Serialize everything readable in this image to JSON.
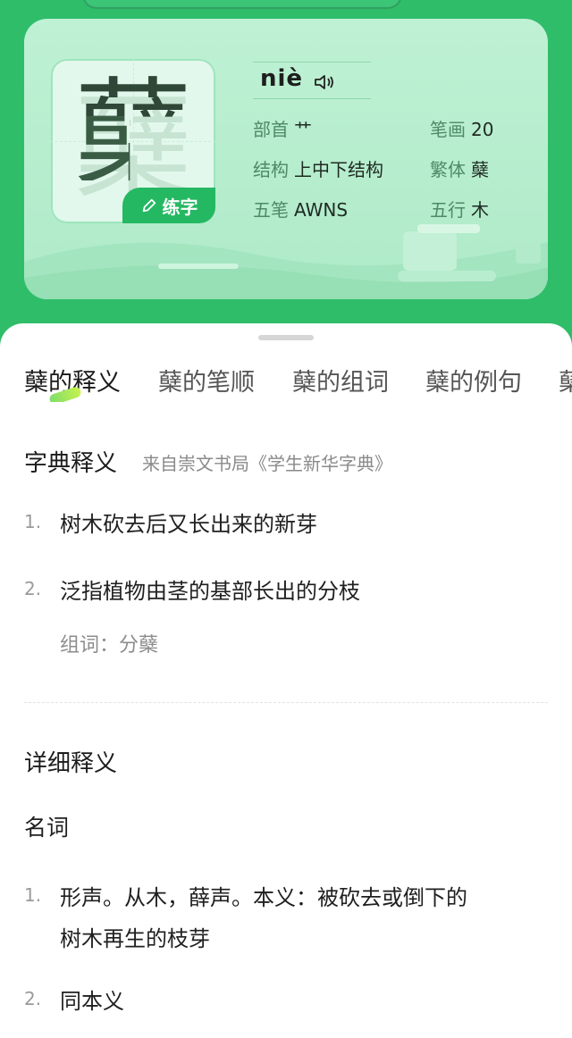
{
  "card": {
    "character": "蘖",
    "practice_label": "练字",
    "pinyin": "niè",
    "info": [
      {
        "label": "部首",
        "value": "艹"
      },
      {
        "label": "笔画",
        "value": "20"
      },
      {
        "label": "结构",
        "value": "上中下结构"
      },
      {
        "label": "繁体",
        "value": "蘖"
      },
      {
        "label": "五笔",
        "value": "AWNS"
      },
      {
        "label": "五行",
        "value": "木"
      }
    ]
  },
  "tabs": [
    {
      "label": "蘖的释义"
    },
    {
      "label": "蘖的笔顺"
    },
    {
      "label": "蘖的组词"
    },
    {
      "label": "蘖的例句"
    },
    {
      "label": "蘖"
    }
  ],
  "dictionary": {
    "title": "字典释义",
    "source": "来自崇文书局《学生新华字典》",
    "items": [
      {
        "num": "1.",
        "text": "树木砍去后又长出来的新芽"
      },
      {
        "num": "2.",
        "text": "泛指植物由茎的基部长出的分枝",
        "sub": "组词：分蘖"
      }
    ]
  },
  "detailed": {
    "title": "详细释义",
    "pos": "名词",
    "items": [
      {
        "num": "1.",
        "line1": "形声。从木，薛声。本义：被砍去或倒下的",
        "line2": "树木再生的枝芽"
      },
      {
        "num": "2.",
        "line1": "同本义"
      }
    ]
  },
  "colors": {
    "brand": "#2fbd6a",
    "card": "#bff1d4",
    "accent": "#25b863"
  }
}
